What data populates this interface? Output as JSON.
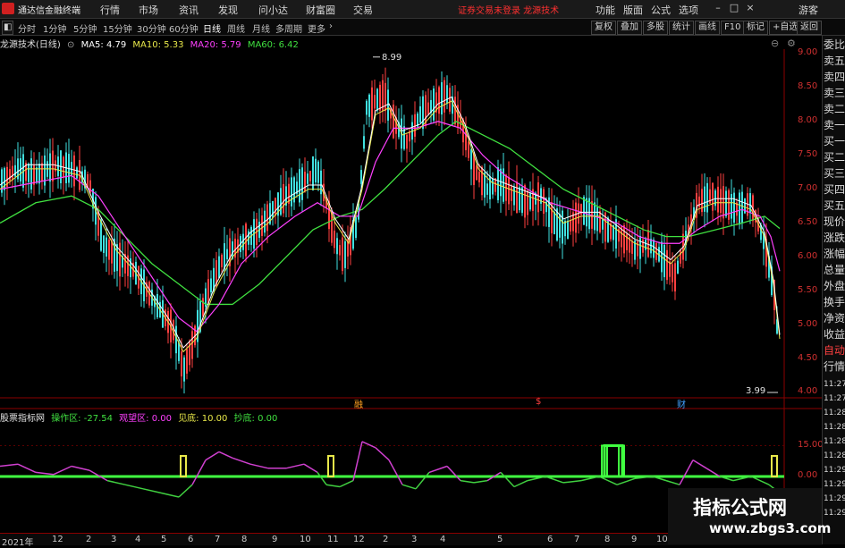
{
  "menu": {
    "app_title": "通达信金融终端",
    "items": [
      "行情",
      "市场",
      "资讯",
      "发现",
      "问小达",
      "财富圈",
      "交易"
    ],
    "notice": "证券交易未登录  龙源技术",
    "right_items": [
      "功能",
      "版面",
      "公式",
      "选项"
    ],
    "guest": "游客"
  },
  "periods": [
    "分时",
    "1分钟",
    "5分钟",
    "15分钟",
    "30分钟",
    "60分钟",
    "日线",
    "周线",
    "月线",
    "多周期",
    "更多"
  ],
  "active_period": "日线",
  "toolbar": [
    "复权",
    "叠加",
    "多股",
    "统计",
    "画线",
    "F10",
    "标记",
    "+自选",
    "返回"
  ],
  "legend": {
    "name": "龙源技术(日线)",
    "ma5": "MA5: 4.79",
    "ma10": "MA10: 5.33",
    "ma20": "MA20: 5.79",
    "ma60": "MA60: 6.42"
  },
  "colors": {
    "ma5": "#ffffff",
    "ma10": "#e8e84a",
    "ma20": "#ff40ff",
    "ma60": "#40e040",
    "up": "#ff4040",
    "down": "#40e0e0",
    "axis": "#d03030"
  },
  "price_axis": [
    "9.00",
    "8.50",
    "8.00",
    "7.50",
    "7.00",
    "6.50",
    "6.00",
    "5.50",
    "5.00",
    "4.50",
    "4.00"
  ],
  "high_label": "8.99",
  "low_label": "3.99",
  "events": [
    "融",
    "$",
    "财"
  ],
  "indicator": {
    "name": "股票指标网",
    "op_zone": "操作区: -27.54",
    "watch_zone": "观望区: 0.00",
    "bottom": "见底: 10.00",
    "buy": "抄底: 0.00",
    "axis": [
      "15.00",
      "0.00"
    ]
  },
  "side_panel": [
    "委比",
    "卖五",
    "卖四",
    "卖三",
    "卖二",
    "卖一",
    "买一",
    "买二",
    "买三",
    "买四",
    "买五",
    "现价",
    "涨跌",
    "涨幅",
    "总量",
    "外盘",
    "换手",
    "净资",
    "收益",
    "自动",
    "行情"
  ],
  "side_times": [
    "11:27",
    "11:27",
    "11:28",
    "11:28",
    "11:28",
    "11:28",
    "11:29",
    "11:29",
    "11:29",
    "11:29"
  ],
  "x_axis": [
    "2021年",
    "12",
    "2",
    "3",
    "4",
    "5",
    "6",
    "7",
    "8",
    "9",
    "10",
    "11",
    "12",
    "2",
    "3",
    "4",
    "5",
    "6",
    "7",
    "8",
    "9",
    "10",
    "11"
  ],
  "watermark": {
    "line1": "指标公式网",
    "line2": "www.zbgs3.com"
  },
  "chart_data": {
    "type": "line",
    "title": "龙源技术(日线)",
    "y_range": [
      4.0,
      9.0
    ],
    "price_path": [
      [
        0,
        7.1
      ],
      [
        20,
        7.3
      ],
      [
        40,
        7.2
      ],
      [
        60,
        7.35
      ],
      [
        80,
        7.3
      ],
      [
        100,
        7.1
      ],
      [
        115,
        6.2
      ],
      [
        130,
        6.0
      ],
      [
        150,
        5.8
      ],
      [
        165,
        5.5
      ],
      [
        180,
        5.2
      ],
      [
        195,
        4.9
      ],
      [
        205,
        4.3
      ],
      [
        215,
        4.7
      ],
      [
        230,
        5.4
      ],
      [
        250,
        6.0
      ],
      [
        270,
        6.2
      ],
      [
        290,
        6.4
      ],
      [
        305,
        6.7
      ],
      [
        320,
        6.9
      ],
      [
        340,
        7.1
      ],
      [
        355,
        7.3
      ],
      [
        365,
        6.8
      ],
      [
        375,
        6.2
      ],
      [
        385,
        6.0
      ],
      [
        400,
        6.5
      ],
      [
        410,
        8.2
      ],
      [
        420,
        8.3
      ],
      [
        430,
        8.4
      ],
      [
        440,
        8.0
      ],
      [
        455,
        7.7
      ],
      [
        470,
        8.1
      ],
      [
        480,
        8.2
      ],
      [
        490,
        8.3
      ],
      [
        500,
        8.4
      ],
      [
        515,
        8.0
      ],
      [
        530,
        7.3
      ],
      [
        545,
        7.0
      ],
      [
        560,
        7.1
      ],
      [
        575,
        6.9
      ],
      [
        590,
        6.8
      ],
      [
        605,
        6.9
      ],
      [
        620,
        6.5
      ],
      [
        635,
        6.4
      ],
      [
        650,
        6.7
      ],
      [
        665,
        6.6
      ],
      [
        680,
        6.4
      ],
      [
        695,
        6.3
      ],
      [
        710,
        6.1
      ],
      [
        725,
        6.2
      ],
      [
        740,
        6.0
      ],
      [
        755,
        5.7
      ],
      [
        765,
        6.2
      ],
      [
        780,
        6.8
      ],
      [
        795,
        6.9
      ],
      [
        810,
        6.8
      ],
      [
        825,
        6.7
      ],
      [
        840,
        6.8
      ],
      [
        855,
        6.2
      ],
      [
        868,
        5.3
      ],
      [
        872,
        3.99
      ]
    ],
    "ma5_path": [
      [
        0,
        7.0
      ],
      [
        30,
        7.3
      ],
      [
        60,
        7.3
      ],
      [
        90,
        7.2
      ],
      [
        110,
        6.6
      ],
      [
        130,
        6.1
      ],
      [
        150,
        5.8
      ],
      [
        170,
        5.4
      ],
      [
        190,
        5.0
      ],
      [
        205,
        4.6
      ],
      [
        220,
        4.8
      ],
      [
        240,
        5.5
      ],
      [
        260,
        6.0
      ],
      [
        280,
        6.3
      ],
      [
        300,
        6.5
      ],
      [
        320,
        6.8
      ],
      [
        345,
        7.0
      ],
      [
        360,
        7.0
      ],
      [
        375,
        6.5
      ],
      [
        390,
        6.2
      ],
      [
        405,
        7.0
      ],
      [
        420,
        8.1
      ],
      [
        435,
        8.2
      ],
      [
        450,
        7.8
      ],
      [
        470,
        7.9
      ],
      [
        490,
        8.2
      ],
      [
        505,
        8.3
      ],
      [
        520,
        7.9
      ],
      [
        535,
        7.3
      ],
      [
        550,
        7.1
      ],
      [
        570,
        7.0
      ],
      [
        590,
        6.9
      ],
      [
        610,
        6.8
      ],
      [
        630,
        6.5
      ],
      [
        650,
        6.6
      ],
      [
        670,
        6.6
      ],
      [
        690,
        6.4
      ],
      [
        710,
        6.2
      ],
      [
        730,
        6.1
      ],
      [
        750,
        5.9
      ],
      [
        765,
        6.1
      ],
      [
        780,
        6.7
      ],
      [
        800,
        6.8
      ],
      [
        820,
        6.8
      ],
      [
        840,
        6.7
      ],
      [
        855,
        6.3
      ],
      [
        865,
        5.6
      ],
      [
        872,
        4.79
      ]
    ],
    "ma20_path": [
      [
        0,
        7.0
      ],
      [
        40,
        7.1
      ],
      [
        80,
        7.2
      ],
      [
        110,
        6.9
      ],
      [
        140,
        6.3
      ],
      [
        170,
        5.7
      ],
      [
        200,
        5.1
      ],
      [
        220,
        4.9
      ],
      [
        245,
        5.3
      ],
      [
        270,
        5.9
      ],
      [
        300,
        6.3
      ],
      [
        330,
        6.6
      ],
      [
        355,
        6.8
      ],
      [
        380,
        6.6
      ],
      [
        400,
        6.6
      ],
      [
        420,
        7.4
      ],
      [
        440,
        7.9
      ],
      [
        465,
        7.9
      ],
      [
        490,
        8.0
      ],
      [
        515,
        7.9
      ],
      [
        540,
        7.5
      ],
      [
        565,
        7.2
      ],
      [
        590,
        7.0
      ],
      [
        615,
        6.8
      ],
      [
        640,
        6.7
      ],
      [
        665,
        6.6
      ],
      [
        690,
        6.5
      ],
      [
        715,
        6.3
      ],
      [
        740,
        6.2
      ],
      [
        760,
        6.2
      ],
      [
        780,
        6.4
      ],
      [
        805,
        6.6
      ],
      [
        830,
        6.7
      ],
      [
        850,
        6.6
      ],
      [
        862,
        6.3
      ],
      [
        872,
        5.79
      ]
    ],
    "ma60_path": [
      [
        0,
        6.5
      ],
      [
        40,
        6.8
      ],
      [
        80,
        6.9
      ],
      [
        110,
        6.7
      ],
      [
        140,
        6.3
      ],
      [
        170,
        5.9
      ],
      [
        200,
        5.6
      ],
      [
        230,
        5.3
      ],
      [
        260,
        5.3
      ],
      [
        290,
        5.6
      ],
      [
        320,
        6.0
      ],
      [
        350,
        6.4
      ],
      [
        380,
        6.6
      ],
      [
        405,
        6.7
      ],
      [
        430,
        7.0
      ],
      [
        460,
        7.4
      ],
      [
        490,
        7.8
      ],
      [
        510,
        8.0
      ],
      [
        540,
        7.8
      ],
      [
        570,
        7.6
      ],
      [
        600,
        7.3
      ],
      [
        630,
        7.0
      ],
      [
        660,
        6.8
      ],
      [
        690,
        6.6
      ],
      [
        720,
        6.4
      ],
      [
        745,
        6.3
      ],
      [
        770,
        6.3
      ],
      [
        800,
        6.4
      ],
      [
        830,
        6.5
      ],
      [
        855,
        6.6
      ],
      [
        872,
        6.42
      ]
    ],
    "indicator_line": [
      [
        0,
        5
      ],
      [
        20,
        6
      ],
      [
        40,
        2
      ],
      [
        60,
        1
      ],
      [
        80,
        5
      ],
      [
        100,
        3
      ],
      [
        120,
        -2
      ],
      [
        140,
        -4
      ],
      [
        160,
        -6
      ],
      [
        180,
        -8
      ],
      [
        200,
        -10
      ],
      [
        215,
        -4
      ],
      [
        230,
        8
      ],
      [
        245,
        12
      ],
      [
        260,
        9
      ],
      [
        280,
        6
      ],
      [
        300,
        4
      ],
      [
        320,
        4
      ],
      [
        340,
        6
      ],
      [
        355,
        2
      ],
      [
        365,
        -4
      ],
      [
        380,
        -5
      ],
      [
        395,
        -2
      ],
      [
        405,
        17
      ],
      [
        420,
        14
      ],
      [
        435,
        8
      ],
      [
        450,
        -4
      ],
      [
        465,
        -6
      ],
      [
        480,
        2
      ],
      [
        500,
        5
      ],
      [
        515,
        -2
      ],
      [
        530,
        -3
      ],
      [
        545,
        -2
      ],
      [
        560,
        2
      ],
      [
        575,
        -5
      ],
      [
        590,
        -2
      ],
      [
        610,
        0
      ],
      [
        630,
        -3
      ],
      [
        650,
        -2
      ],
      [
        670,
        0
      ],
      [
        690,
        -4
      ],
      [
        710,
        -1
      ],
      [
        730,
        0
      ],
      [
        745,
        -2
      ],
      [
        760,
        -4
      ],
      [
        775,
        8
      ],
      [
        790,
        4
      ],
      [
        805,
        0
      ],
      [
        820,
        -2
      ],
      [
        840,
        0
      ],
      [
        860,
        -4
      ],
      [
        872,
        -8
      ]
    ],
    "signal_bars": [
      [
        205,
        10
      ],
      [
        370,
        10
      ],
      [
        676,
        15
      ],
      [
        695,
        15
      ],
      [
        866,
        10
      ]
    ]
  }
}
